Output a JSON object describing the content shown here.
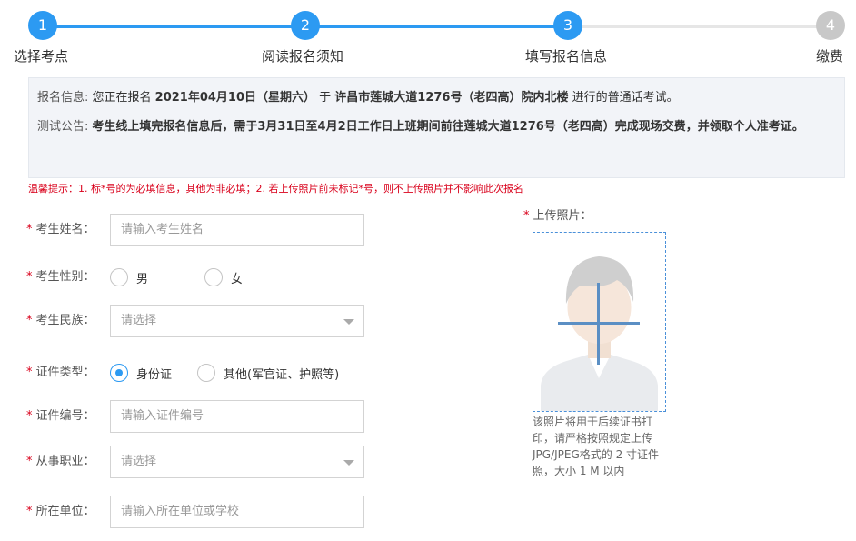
{
  "stepper": {
    "steps": [
      {
        "num": "1",
        "label": "选择考点",
        "state": "done"
      },
      {
        "num": "2",
        "label": "阅读报名须知",
        "state": "done"
      },
      {
        "num": "3",
        "label": "填写报名信息",
        "state": "done"
      },
      {
        "num": "4",
        "label": "缴费",
        "state": "todo"
      }
    ],
    "colors": {
      "active": "#2c9af2",
      "inactive": "#c8c8c8"
    }
  },
  "notice": {
    "info_key": "报名信息:",
    "info_pre": " 您正在报名 ",
    "info_date": "2021年04月10日（星期六）",
    "info_mid": " 于 ",
    "info_place": "许昌市莲城大道1276号（老四高）院内北楼",
    "info_post": " 进行的普通话考试。",
    "announce_key": "测试公告:",
    "announce_text": "考生线上填完报名信息后，需于3月31日至4月2日工作日上班期间前往莲城大道1276号（老四高）完成现场交费，并领取个人准考证。"
  },
  "warm_tip": "温馨提示：1. 标*号的为必填信息，其他为非必填；2. 若上传照片前未标记*号，则不上传照片并不影响此次报名",
  "form": {
    "star": "*",
    "name": {
      "label": "考生姓名：",
      "placeholder": "请输入考生姓名"
    },
    "gender": {
      "label": "考生性别：",
      "options": [
        "男",
        "女"
      ],
      "selected": null
    },
    "ethnicity": {
      "label": "考生民族：",
      "placeholder": "请选择"
    },
    "id_type": {
      "label": "证件类型：",
      "options": [
        "身份证",
        "其他(军官证、护照等)"
      ],
      "selected": "身份证"
    },
    "id_number": {
      "label": "证件编号：",
      "placeholder": "请输入证件编号"
    },
    "occupation": {
      "label": "从事职业：",
      "placeholder": "请选择"
    },
    "workplace": {
      "label": "所在单位：",
      "placeholder": "请输入所在单位或学校"
    }
  },
  "photo": {
    "label": "上传照片：",
    "hint": "该照片将用于后续证书打印，请严格按照规定上传JPG/JPEG格式的 2 寸证件照，大小 1 M 以内",
    "icons": [
      "avatar-placeholder-icon",
      "plus-icon"
    ]
  },
  "colors": {
    "accent": "#2c9af2",
    "required": "#d9001b",
    "notice_bg": "#f2f4f8"
  }
}
